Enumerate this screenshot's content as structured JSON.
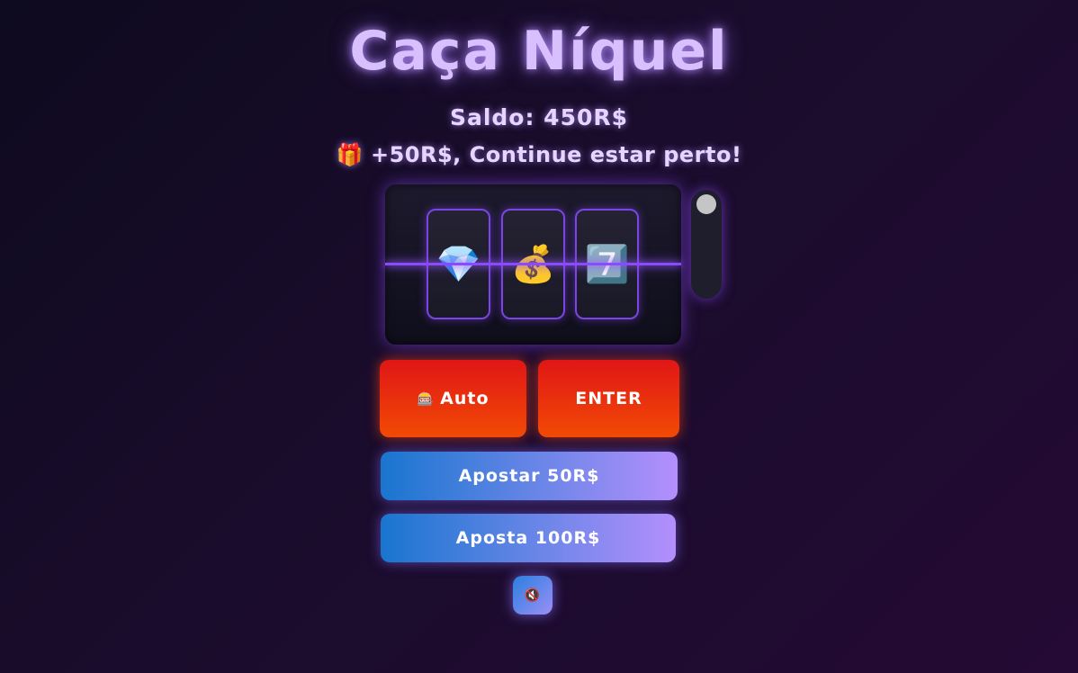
{
  "header": {
    "title": "Caça Níquel",
    "balance": "Saldo: 450R$",
    "message_icon": "🎁",
    "message": "+50R$, Continue estar perto!"
  },
  "machine": {
    "reels": [
      {
        "symbol": "💎",
        "icon": "diamond-icon"
      },
      {
        "symbol": "💰",
        "icon": "money-bag-icon"
      },
      {
        "symbol": "7️⃣",
        "icon": "seven-icon"
      }
    ]
  },
  "controls": {
    "auto_icon": "🎰",
    "auto_label": "Auto",
    "enter_label": "ENTER",
    "bet50_label": "Apostar 50R$",
    "bet100_label": "Aposta 100R$",
    "mute_icon": "🔇"
  },
  "colors": {
    "accent": "#8a4bff",
    "red_button": "#e01616",
    "blue_button_start": "#1976cf",
    "blue_button_end": "#b48ffc"
  }
}
